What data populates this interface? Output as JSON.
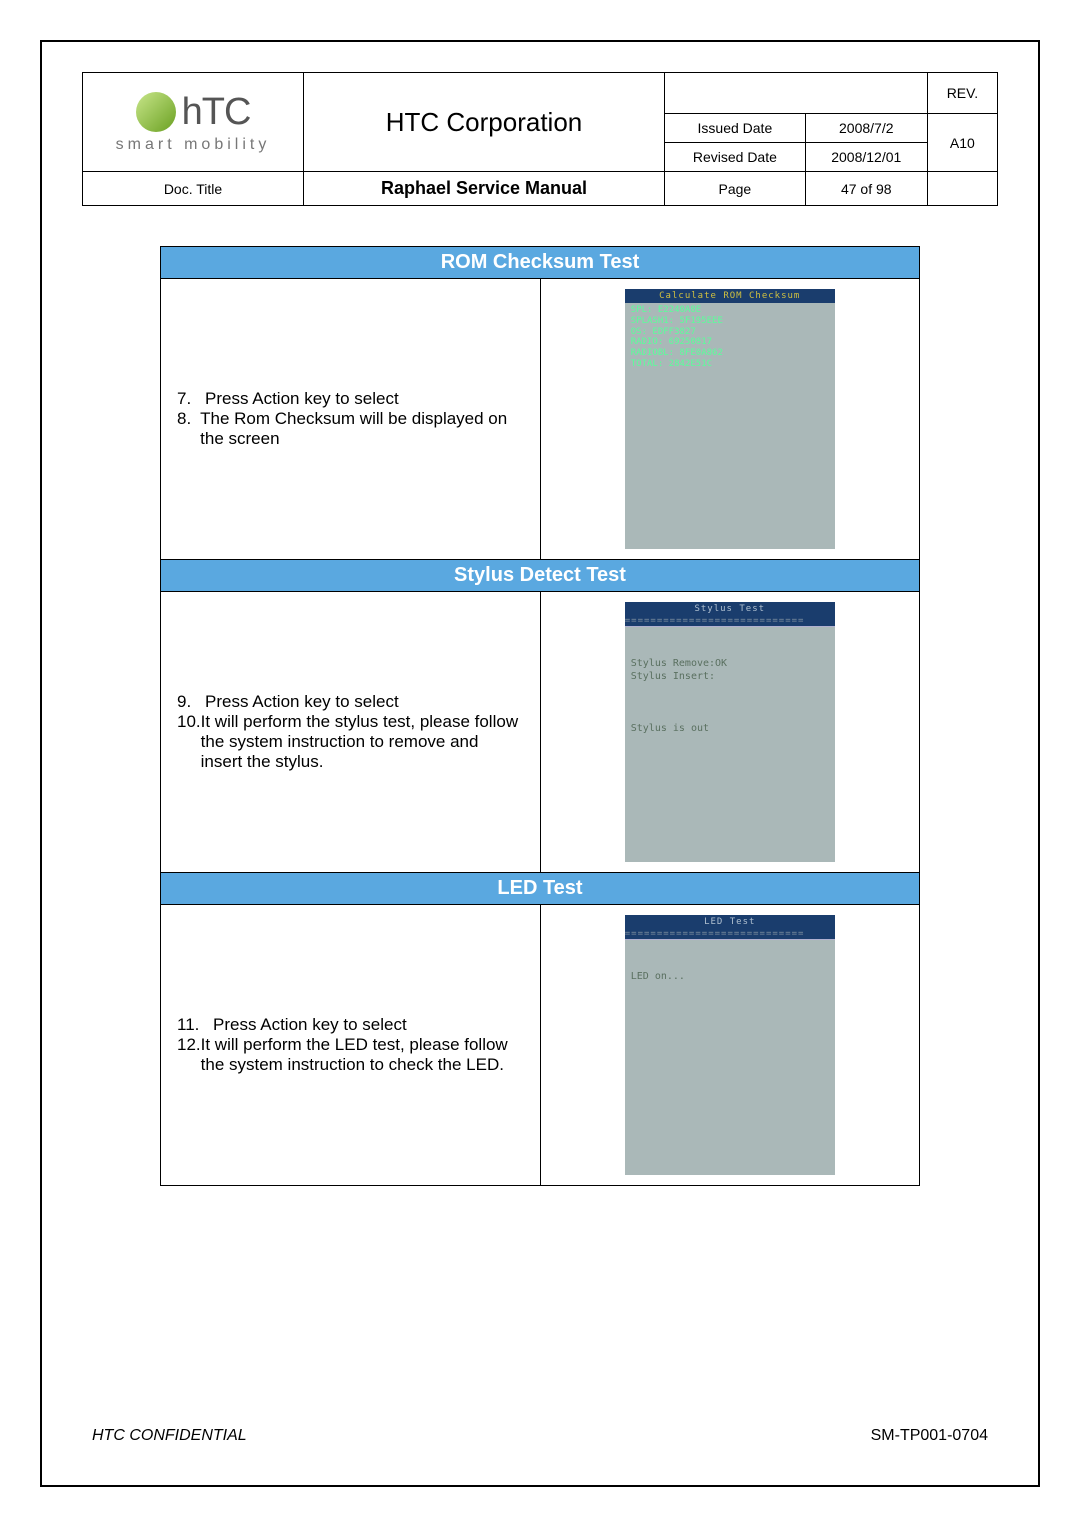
{
  "header": {
    "logo_brand": "hTC",
    "logo_tagline": "smart mobility",
    "corporation": "HTC Corporation",
    "rev_label": "REV.",
    "issued_date_label": "Issued Date",
    "issued_date": "2008/7/2",
    "revised_date_label": "Revised Date",
    "revised_date": "2008/12/01",
    "rev_value": "A10",
    "doc_title_label": "Doc. Title",
    "doc_title": "Raphael Service Manual",
    "page_label": "Page",
    "page_value": "47 of 98"
  },
  "sections": [
    {
      "title": "ROM Checksum Test",
      "steps": [
        {
          "num": "7.",
          "text": "Press Action key to select"
        },
        {
          "num": "8.",
          "text": "The Rom Checksum will be displayed on the screen"
        }
      ],
      "screen": {
        "topbar": "Calculate ROM Checksum",
        "topbar_class": "yellow",
        "lines": [
          "SPL:     E2240A8E",
          "SPLASH1: 5F195EEE",
          "OS:      EDFF3827",
          "RADIO:   69250817",
          "RADIOBL: 8FE0A862",
          "TOTAL:   2842E51C"
        ],
        "body_color": "#5aff9a"
      }
    },
    {
      "title": "Stylus Detect Test",
      "steps": [
        {
          "num": "9.",
          "text": "Press Action key to select"
        },
        {
          "num": "10.",
          "text": "It will perform the stylus test, please follow the system instruction to remove and insert the stylus."
        }
      ],
      "screen": {
        "topbar": "Stylus Test",
        "underline": "============================",
        "lines": [
          "",
          "",
          "Stylus Remove:OK",
          "Stylus Insert:",
          "",
          "",
          "",
          "Stylus is out"
        ]
      }
    },
    {
      "title": "LED Test",
      "steps": [
        {
          "num": "11.",
          "text": "Press Action key to select"
        },
        {
          "num": "12.",
          "text": "It will perform the LED test, please follow the system instruction to check the LED."
        }
      ],
      "screen": {
        "topbar": "LED Test",
        "underline": "============================",
        "lines": [
          "",
          "",
          "LED on..."
        ]
      }
    }
  ],
  "footer": {
    "confidential": "HTC CONFIDENTIAL",
    "doc_number": "SM-TP001-0704"
  }
}
